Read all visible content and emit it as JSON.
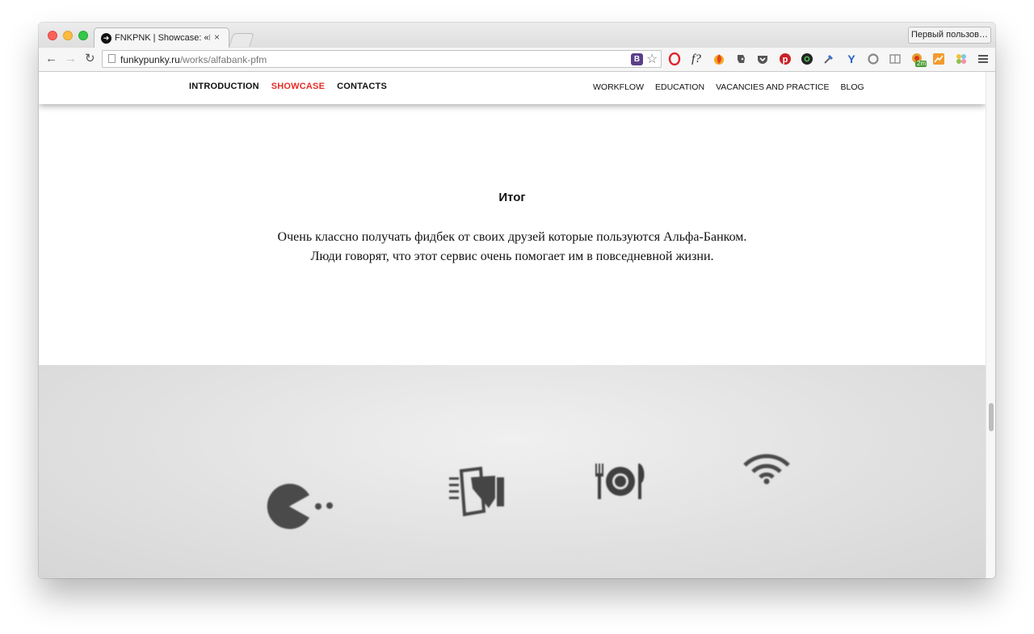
{
  "browser": {
    "tab_title": "FNKPNK | Showcase: «Рас",
    "tab_close": "×",
    "profile_button": "Первый пользов…",
    "url_host": "funkypunky.ru",
    "url_path": "/works/alfabank-pfm",
    "omnibox_badge": "B",
    "extensions": [
      "opera-icon",
      "f?",
      "flame-icon",
      "evernote-icon",
      "pocket-icon",
      "pinterest-icon",
      "camera-icon",
      "eyedropper-icon",
      "y-icon",
      "refresh-circle-icon",
      "reader-icon",
      "badge-icon",
      "chart-icon",
      "puzzle-icon",
      "menu-icon"
    ],
    "ext_f_label": "f?",
    "ext_badge_count": "2m"
  },
  "site_nav": {
    "left": [
      {
        "label": "INTRODUCTION",
        "active": false
      },
      {
        "label": "SHOWCASE",
        "active": true
      },
      {
        "label": "CONTACTS",
        "active": false
      }
    ],
    "right": [
      {
        "label": "WORKFLOW"
      },
      {
        "label": "EDUCATION"
      },
      {
        "label": "VACANCIES AND PRACTICE"
      },
      {
        "label": "BLOG"
      }
    ],
    "active_color": "#e52d27"
  },
  "summary": {
    "title": "Итог",
    "line1": "Очень классно получать фидбек от своих друзей которые пользуются Альфа-Банком.",
    "line2": "Люди говорят, что этот сервис очень помогает им в повседневной жизни."
  },
  "category_icons": [
    "pacman-icon",
    "receipt-hand-icon",
    "dining-plate-icon",
    "wifi-icon"
  ]
}
